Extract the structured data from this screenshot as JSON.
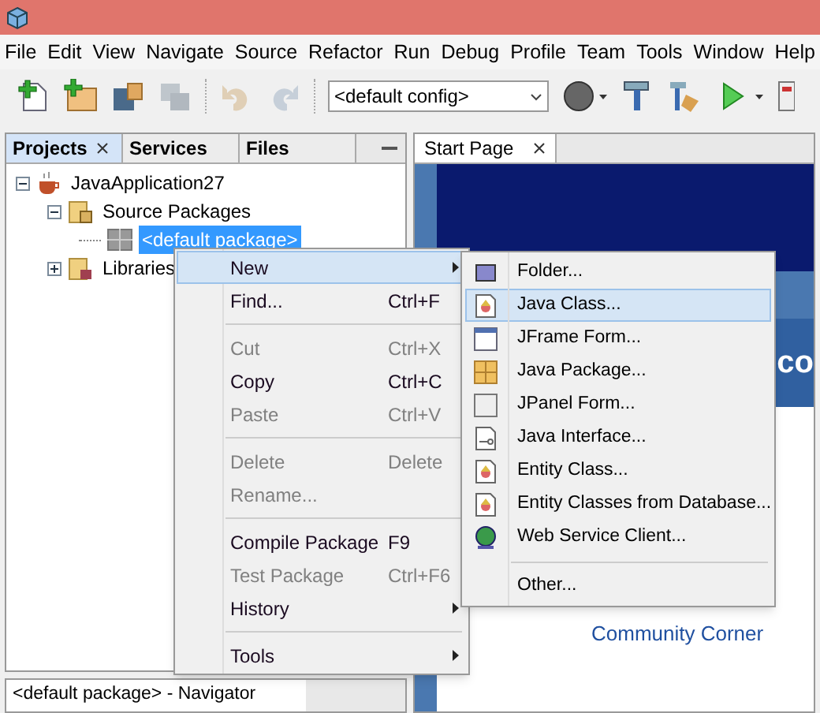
{
  "menubar": [
    "File",
    "Edit",
    "View",
    "Navigate",
    "Source",
    "Refactor",
    "Run",
    "Debug",
    "Profile",
    "Team",
    "Tools",
    "Window",
    "Help"
  ],
  "toolbar": [
    {
      "kind": "new-file",
      "disabled": false
    },
    {
      "kind": "new-project",
      "disabled": false
    },
    {
      "kind": "open-project",
      "disabled": false
    },
    {
      "kind": "save-all",
      "disabled": true
    },
    {
      "kind": "sep"
    },
    {
      "kind": "undo",
      "disabled": true
    },
    {
      "kind": "redo",
      "disabled": true
    },
    {
      "kind": "sep"
    },
    {
      "kind": "config",
      "value": "<default config>"
    },
    {
      "kind": "globe",
      "dropdown": true
    },
    {
      "kind": "hammer"
    },
    {
      "kind": "clean"
    },
    {
      "kind": "run",
      "dropdown": true
    },
    {
      "kind": "profile"
    }
  ],
  "projects_panel": {
    "tabs": [
      {
        "label": "Projects",
        "selected": true,
        "closable": true
      },
      {
        "label": "Services",
        "selected": false,
        "closable": false
      },
      {
        "label": "Files",
        "selected": false,
        "closable": false
      }
    ],
    "tree": [
      {
        "label": "JavaApplication27",
        "kind": "project",
        "expanded": true,
        "selected": false,
        "children": [
          {
            "label": "Source Packages",
            "kind": "source",
            "expanded": true,
            "selected": false,
            "children": [
              {
                "label": "<default package>",
                "kind": "package",
                "selected": true
              }
            ]
          },
          {
            "label": "Libraries",
            "kind": "library",
            "expanded": false,
            "selected": false
          }
        ]
      }
    ]
  },
  "navigator_tab": {
    "label": "<default package> - Navigator"
  },
  "editor_tab": {
    "label": "Start Page",
    "selected": true
  },
  "start_page": {
    "heading_fragment": "co",
    "link": "Community Corner"
  },
  "context_menu": [
    {
      "kind": "item",
      "label": "New",
      "submenu": true,
      "selected": true,
      "disabled": false
    },
    {
      "kind": "item",
      "label": "Find...",
      "shortcut": "Ctrl+F",
      "selected": false,
      "disabled": false
    },
    {
      "kind": "separator"
    },
    {
      "kind": "item",
      "label": "Cut",
      "shortcut": "Ctrl+X",
      "selected": false,
      "disabled": true
    },
    {
      "kind": "item",
      "label": "Copy",
      "shortcut": "Ctrl+C",
      "selected": false,
      "disabled": false
    },
    {
      "kind": "item",
      "label": "Paste",
      "shortcut": "Ctrl+V",
      "selected": false,
      "disabled": true
    },
    {
      "kind": "separator"
    },
    {
      "kind": "item",
      "label": "Delete",
      "shortcut": "Delete",
      "selected": false,
      "disabled": true
    },
    {
      "kind": "item",
      "label": "Rename...",
      "selected": false,
      "disabled": true
    },
    {
      "kind": "separator"
    },
    {
      "kind": "item",
      "label": "Compile Package",
      "shortcut": "F9",
      "selected": false,
      "disabled": false
    },
    {
      "kind": "item",
      "label": "Test Package",
      "shortcut": "Ctrl+F6",
      "selected": false,
      "disabled": true
    },
    {
      "kind": "item",
      "label": "History",
      "submenu": true,
      "selected": false,
      "disabled": false
    },
    {
      "kind": "separator"
    },
    {
      "kind": "item",
      "label": "Tools",
      "submenu": true,
      "selected": false,
      "disabled": false
    }
  ],
  "new_submenu": [
    {
      "kind": "folder",
      "label": "Folder...",
      "selected": false
    },
    {
      "kind": "class",
      "label": "Java Class...",
      "selected": true
    },
    {
      "kind": "frame",
      "label": "JFrame Form...",
      "selected": false
    },
    {
      "kind": "package",
      "label": "Java Package...",
      "selected": false
    },
    {
      "kind": "panel",
      "label": "JPanel Form...",
      "selected": false
    },
    {
      "kind": "interface",
      "label": "Java Interface...",
      "selected": false
    },
    {
      "kind": "class",
      "label": "Entity Class...",
      "selected": false
    },
    {
      "kind": "class",
      "label": "Entity Classes from Database...",
      "selected": false
    },
    {
      "kind": "globe",
      "label": "Web Service Client...",
      "selected": false
    },
    {
      "kind": "separator"
    },
    {
      "kind": "plain",
      "label": "Other...",
      "selected": false
    }
  ]
}
